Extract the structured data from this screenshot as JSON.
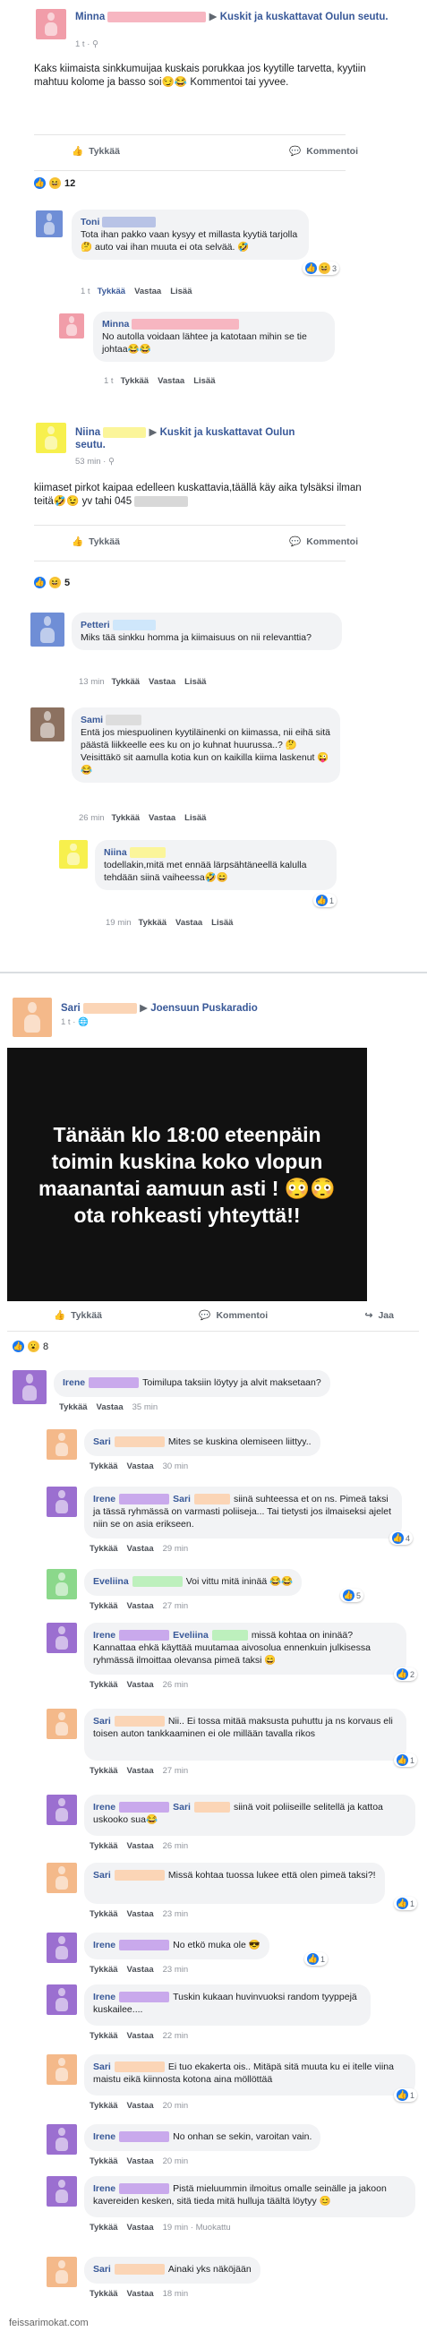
{
  "colors": {
    "link": "#385898",
    "bubble": "#f2f3f5",
    "like_blue": "#1877f2",
    "pink": "#f19da9",
    "yellow": "#f7f04d",
    "orange": "#f4b98a",
    "purple": "#9b6fd0",
    "blue": "#6f8ed6",
    "brown": "#8c7160",
    "green": "#8bd88b",
    "black": "#111111"
  },
  "labels": {
    "like": "Tykkää",
    "comment": "Kommentoi",
    "share": "Jaa",
    "reply": "Vastaa",
    "more": "Lisää",
    "edited": "Muokattu"
  },
  "post1": {
    "author": "Minna",
    "arrow": "▶",
    "group": "Kuskit ja kuskattavat Oulun seutu.",
    "time": "1 t · ⚲",
    "text": "Kaks kiimaista sinkkumuijaa kuskais porukkaa jos kyytille tarvetta, kyytiin mahtuu kolome ja basso soi😏😂 Kommentoi tai yyvee.",
    "reaction_count": "12",
    "comments": [
      {
        "name": "Toni",
        "text": "Tota ihan pakko vaan kysyy et millasta kyytiä tarjolla🤔 auto vai ihan muuta ei ota selvää. 🤣",
        "time": "1 t",
        "reacts": "3"
      },
      {
        "name": "Minna",
        "text": "No autolla voidaan lähtee ja katotaan mihin se tie johtaa😂😂",
        "time": "1 t"
      }
    ]
  },
  "post2": {
    "author": "Niina",
    "arrow": "▶",
    "group": "Kuskit ja kuskattavat Oulun seutu.",
    "time": "53 min · ⚲",
    "text": "kiimaset pirkot kaipaa edelleen kuskattavia,täällä käy aika tylsäksi ilman teitä🤣😉 yv tahi 045",
    "reaction_count": "5",
    "comments": [
      {
        "name": "Petteri",
        "text": "Miks tää sinkku homma ja kiimaisuus on nii relevanttia?",
        "time": "13 min"
      },
      {
        "name": "Sami",
        "text": "Entä jos miespuolinen kyytiläinenki on kiimassa, nii eihä sitä päästä liikkeelle ees ku on jo kuhnat huurussa..? 🤔 Veisittäkö sit aamulla kotia kun on kaikilla kiima laskenut 😜😂",
        "time": "26 min"
      },
      {
        "name": "Niina",
        "text": "todellakin,mitä met ennää lärpsähtäneellä kalulla tehdään siinä vaiheessa🤣😄",
        "time": "19 min",
        "reacts": "1"
      }
    ]
  },
  "post3": {
    "author": "Sari",
    "arrow": "▶",
    "group": "Joensuun Puskaradio",
    "time": "1 t · 🌐",
    "image_text": "Tänään klo 18:00 eteenpäin toimin kuskina koko vlopun maanantai aamuun asti ! 😳😳 ota rohkeasti yhteyttä!!",
    "reaction_count": "8",
    "comments": [
      {
        "name": "Irene",
        "text": "Toimilupa taksiin löytyy ja alvit maksetaan?",
        "time": "35 min"
      },
      {
        "name": "Sari",
        "text": "Mites se kuskina olemiseen liittyy..",
        "time": "30 min"
      },
      {
        "name": "Irene",
        "mention": "Sari",
        "text": "siinä suhteessa et on ns. Pimeä taksi ja tässä ryhmässä on varmasti poliiseja... Tai tietysti jos ilmaiseksi ajelet niin se on asia erikseen.",
        "time": "29 min",
        "reacts": "4"
      },
      {
        "name": "Eveliina",
        "text": "Voi vittu mitä ininää 😂😂",
        "time": "27 min",
        "reacts": "5"
      },
      {
        "name": "Irene",
        "mention": "Eveliina",
        "text": "missä kohtaa on ininää? Kannattaa ehkä käyttää muutamaa aivosolua ennenkuin julkisessa ryhmässä ilmoittaa olevansa pimeä taksi 😄",
        "time": "26 min",
        "reacts": "2"
      },
      {
        "name": "Sari",
        "text": "Nii.. Ei tossa mitää maksusta puhuttu ja ns korvaus eli toisen auton tankkaaminen ei ole millään tavalla rikos",
        "time": "27 min",
        "reacts": "1"
      },
      {
        "name": "Irene",
        "mention": "Sari",
        "text": "siinä voit poliiseille selitellä ja kattoa uskooko sua😂",
        "time": "26 min"
      },
      {
        "name": "Sari",
        "text": "Missä kohtaa tuossa lukee että olen pimeä taksi?!",
        "time": "23 min",
        "reacts": "1"
      },
      {
        "name": "Irene",
        "text": "No etkö muka ole 😎",
        "time": "23 min",
        "reacts": "1"
      },
      {
        "name": "Irene",
        "text": "Tuskin kukaan huvinvuoksi random tyyppejä kuskailee....",
        "time": "22 min"
      },
      {
        "name": "Sari",
        "text": "Ei tuo ekakerta ois.. Mitäpä sitä muuta ku ei itelle viina maistu eikä kiinnosta kotona aina möllöttää",
        "time": "20 min",
        "reacts": "1"
      },
      {
        "name": "Irene",
        "text": "No onhan se sekin, varoitan vain.",
        "time": "20 min"
      },
      {
        "name": "Irene",
        "text": "Pistä mieluummin ilmoitus omalle seinälle ja jakoon kavereiden kesken, sitä tieda mitä hulluja täältä löytyy 😊",
        "time": "19 min",
        "edited": true
      },
      {
        "name": "Sari",
        "text": "Ainaki yks näköjään",
        "time": "18 min"
      }
    ]
  },
  "watermark": "feissarimokat.com"
}
